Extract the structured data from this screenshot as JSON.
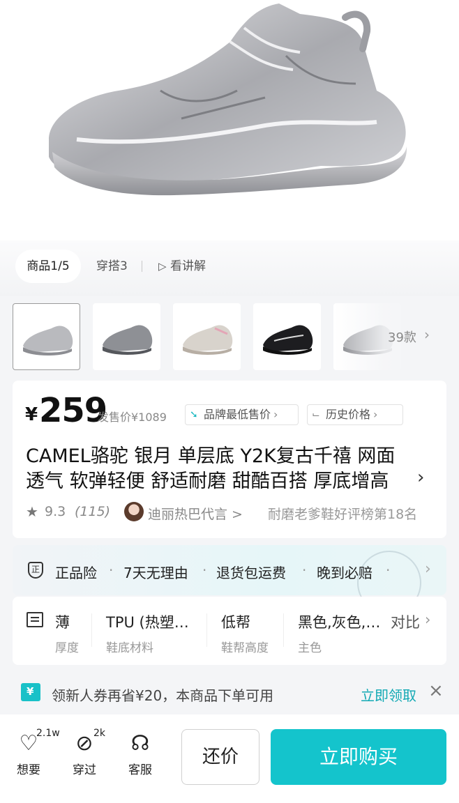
{
  "media_tabs": {
    "product": "商品1/5",
    "outfit": "穿搭3",
    "explain": "看讲解"
  },
  "thumbnails": {
    "more_count": "39款"
  },
  "price": {
    "currency": "¥",
    "value": "259",
    "original": "发售价¥1089",
    "brand_lowest": "品牌最低售价",
    "history": "历史价格"
  },
  "title": {
    "line1": "CAMEL骆驼 银月 单层底 Y2K复古千禧 网面",
    "line2": "透气 软弹轻便 舒适耐磨 甜酷百搭 厚底增高"
  },
  "meta": {
    "rating": "9.3",
    "review_count": "(115)",
    "endorser": "迪丽热巴代言 >",
    "rank": "耐磨老爹鞋好评榜第18名"
  },
  "guarantee": {
    "items": [
      "正品险",
      "7天无理由",
      "退货包运费",
      "晚到必赔"
    ]
  },
  "attributes": {
    "items": [
      {
        "value": "薄",
        "label": "厚度"
      },
      {
        "value": "TPU (热塑…",
        "label": "鞋底材料"
      },
      {
        "value": "低帮",
        "label": "鞋帮高度"
      },
      {
        "value": "黑色,灰色,…",
        "label": "主色"
      }
    ],
    "compare": "对比"
  },
  "coupon": {
    "text": "领新人券再省¥20，本商品下单可用",
    "claim": "立即领取"
  },
  "bottom_bar": {
    "wishlist": {
      "label": "想要",
      "count": "2.1w"
    },
    "worn": {
      "label": "穿过",
      "count": "2k"
    },
    "service": {
      "label": "客服"
    },
    "haggle": "还价",
    "buy": "立即购买"
  },
  "colors": {
    "accent": "#14c4cc",
    "accent_text": "#12a9b4"
  }
}
